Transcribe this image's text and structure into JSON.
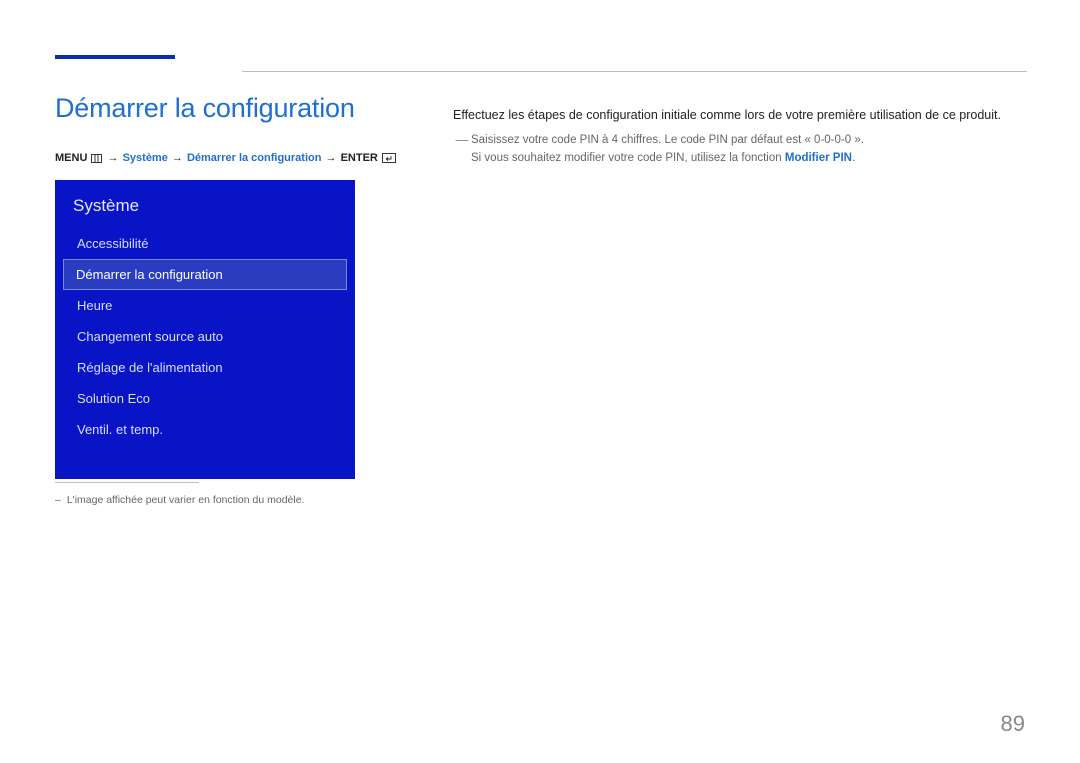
{
  "page_title": "Démarrer la configuration",
  "breadcrumb": {
    "menu": "MENU",
    "arrow": "→",
    "systeme": "Système",
    "demarrer": "Démarrer la configuration",
    "enter": "ENTER"
  },
  "menu_panel": {
    "title": "Système",
    "items": [
      {
        "label": "Accessibilité",
        "selected": false
      },
      {
        "label": "Démarrer la configuration",
        "selected": true
      },
      {
        "label": "Heure",
        "selected": false
      },
      {
        "label": "Changement source auto",
        "selected": false
      },
      {
        "label": "Réglage de l'alimentation",
        "selected": false
      },
      {
        "label": "Solution Eco",
        "selected": false
      },
      {
        "label": "Ventil. et temp.",
        "selected": false
      }
    ]
  },
  "body": {
    "intro": "Effectuez les étapes de configuration initiale comme lors de votre première utilisation de ce produit.",
    "note_line1": "Saisissez votre code PIN à 4 chiffres. Le code PIN par défaut est « 0-0-0-0 ».",
    "note_line2_pre": "Si vous souhaitez modifier votre code PIN, utilisez la fonction ",
    "note_line2_highlight": "Modifier PIN",
    "note_line2_post": "."
  },
  "footnote": "L'image affichée peut varier en fonction du modèle.",
  "page_number": "89"
}
